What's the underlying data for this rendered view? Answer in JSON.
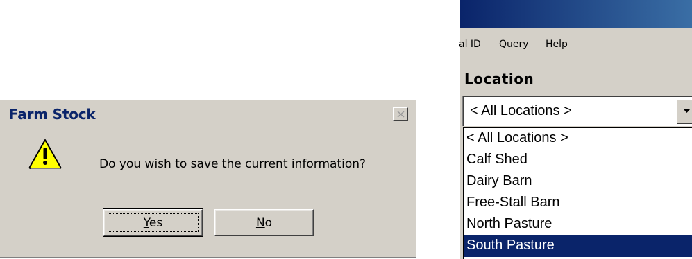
{
  "dialog": {
    "title": "Farm Stock",
    "message": "Do you wish to save the current information?",
    "icon": "warning-icon",
    "buttons": {
      "yes": "Yes",
      "no": "No"
    }
  },
  "app": {
    "menu": [
      {
        "label": "al ID"
      },
      {
        "label": "Query"
      },
      {
        "label": "Help"
      }
    ],
    "location_label": "Location",
    "location_combo": {
      "selected": "< All Locations >"
    },
    "location_list": [
      {
        "label": "< All Locations >"
      },
      {
        "label": "Calf Shed"
      },
      {
        "label": "Dairy Barn"
      },
      {
        "label": "Free-Stall Barn"
      },
      {
        "label": "North Pasture"
      },
      {
        "label": "South Pasture",
        "selected": true
      }
    ],
    "colors": {
      "title_gradient_start": "#0a246a",
      "title_gradient_end": "#3a6ea5",
      "selection": "#0a246a",
      "face": "#d4d0c8"
    }
  }
}
